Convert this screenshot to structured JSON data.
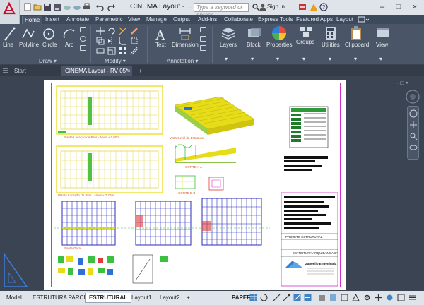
{
  "window": {
    "title": "CINEMA Layout - ...",
    "search_placeholder": "Type a keyword or phrase",
    "sign_in": "Sign In"
  },
  "ribbon_tabs": [
    "Home",
    "Insert",
    "Annotate",
    "Parametric",
    "View",
    "Manage",
    "Output",
    "Add-ins",
    "Collaborate",
    "Express Tools",
    "Featured Apps",
    "Layout"
  ],
  "active_tab": "Home",
  "ribbon": {
    "draw": {
      "title": "Draw ▾",
      "tools": [
        "Line",
        "Polyline",
        "Circle",
        "Arc"
      ]
    },
    "modify": {
      "title": "Modify ▾"
    },
    "annotation": {
      "title": "Annotation ▾",
      "tools": [
        "Text",
        "Dimension"
      ]
    },
    "big_buttons": [
      "Layers",
      "Block",
      "Properties",
      "Groups",
      "Utilities",
      "Clipboard",
      "View"
    ]
  },
  "file_tabs": [
    "Start",
    "CINEMA Layout - RV 05*"
  ],
  "drawing_labels": {
    "plan1": "Planta Locação de Pilar - Nivel + 0,00m",
    "plan2": "Planta Locação de Pilar - Nivel + 2,71m",
    "plan3": "Planta Geral",
    "view3d": "Vista Geral da Estrutura",
    "corte_a": "CORTE A-A",
    "corte_b": "CORTE B-B",
    "projeto": "PROJETO ESTRUTURAL",
    "estrutura": "ESTRUTURA ARQUIBANCADA",
    "empresa": "Zanoello Engenharia"
  },
  "layout_tabs": [
    "Model",
    "ESTRUTURA PARCIAL",
    "ESTRUTURAL",
    "Layout1",
    "Layout2"
  ],
  "active_layout": "ESTRUTURAL",
  "status": {
    "space": "PAPER"
  },
  "colors": {
    "accent": "#3d85c6",
    "ribbon_bg": "#4a5567",
    "paper": "#ffffff",
    "viewport_border": "#cc33cc"
  }
}
